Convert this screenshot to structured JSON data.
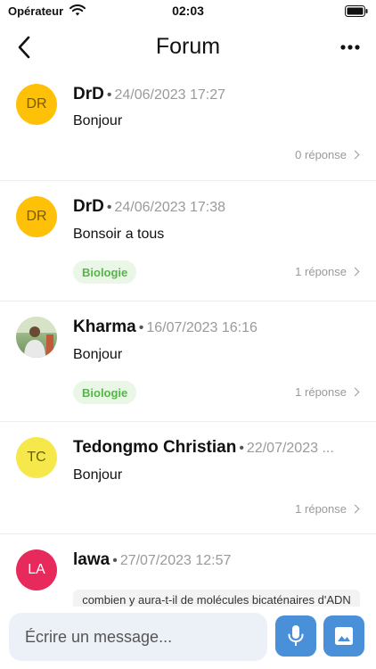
{
  "status_bar": {
    "carrier": "Opérateur",
    "time": "02:03"
  },
  "nav": {
    "title": "Forum"
  },
  "posts": [
    {
      "initials": "DR",
      "avatar_bg": "#ffc107",
      "avatar_fg": "#7a5a00",
      "author": "DrD",
      "date": "24/06/2023 17:27",
      "text": "Bonjour",
      "tag": "",
      "replies": "0 réponse"
    },
    {
      "initials": "DR",
      "avatar_bg": "#ffc107",
      "avatar_fg": "#7a5a00",
      "author": "DrD",
      "date": "24/06/2023 17:38",
      "text": "Bonsoir a tous",
      "tag": "Biologie",
      "replies": "1 réponse"
    },
    {
      "initials": "",
      "avatar_bg": "#9bb28a",
      "avatar_fg": "#ffffff",
      "author": "Kharma",
      "date": "16/07/2023 16:16",
      "text": "Bonjour",
      "tag": "Biologie",
      "replies": "1 réponse"
    },
    {
      "initials": "TC",
      "avatar_bg": "#f6e84a",
      "avatar_fg": "#6b6000",
      "author": "Tedongmo Christian",
      "date": "22/07/2023 ...",
      "text": "Bonjour",
      "tag": "",
      "replies": "1 réponse"
    },
    {
      "initials": "LA",
      "avatar_bg": "#e8295c",
      "avatar_fg": "#ffffff",
      "author": "lawa",
      "date": "27/07/2023 12:57",
      "text": "combien y aura-t-il de molécules bicaténaires d'ADN dans un de ses ovules ?",
      "tag": "",
      "replies": ""
    }
  ],
  "composer": {
    "placeholder": "Écrire un message..."
  },
  "colors": {
    "accent": "#4a90d9",
    "tag_bg": "#eaf7e6",
    "tag_fg": "#55b548"
  },
  "icons": {
    "back": "chevron-left-icon",
    "more": "ellipsis-icon",
    "mic": "microphone-icon",
    "image": "image-icon"
  }
}
